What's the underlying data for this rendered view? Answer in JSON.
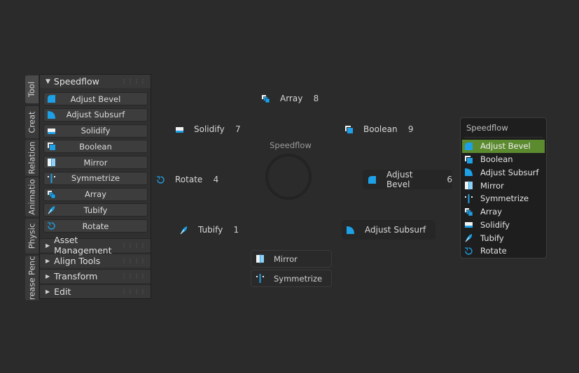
{
  "side_tabs": [
    "Tool",
    "Creat",
    "Relation",
    "Animatio",
    "Physic",
    "rease Penc"
  ],
  "panel": {
    "title": "Speedflow",
    "buttons": [
      {
        "label": "Adjust Bevel",
        "icon": "bevel-icon"
      },
      {
        "label": "Adjust Subsurf",
        "icon": "subsurf-icon"
      },
      {
        "label": "Solidify",
        "icon": "solidify-icon"
      },
      {
        "label": "Boolean",
        "icon": "boolean-icon"
      },
      {
        "label": "Mirror",
        "icon": "mirror-icon"
      },
      {
        "label": "Symmetrize",
        "icon": "symmetrize-icon"
      },
      {
        "label": "Array",
        "icon": "array-icon"
      },
      {
        "label": "Tubify",
        "icon": "tubify-icon"
      },
      {
        "label": "Rotate",
        "icon": "rotate-icon"
      }
    ],
    "sections": [
      "Asset Management",
      "Align Tools",
      "Transform",
      "Edit"
    ]
  },
  "pie": {
    "title": "Speedflow",
    "items": [
      {
        "label": "Array",
        "num": "8",
        "icon": "array-icon"
      },
      {
        "label": "Solidify",
        "num": "7",
        "icon": "solidify-icon"
      },
      {
        "label": "Boolean",
        "num": "9",
        "icon": "boolean-icon"
      },
      {
        "label": "Rotate",
        "num": "4",
        "icon": "rotate-icon"
      },
      {
        "label": "Adjust Bevel",
        "num": "6",
        "icon": "bevel-icon"
      },
      {
        "label": "Tubify",
        "num": "1",
        "icon": "tubify-icon"
      },
      {
        "label": "Adjust Subsurf",
        "num": "",
        "icon": "subsurf-icon"
      }
    ],
    "extras": [
      {
        "label": "Mirror",
        "icon": "mirror-icon"
      },
      {
        "label": "Symmetrize",
        "icon": "symmetrize-icon"
      }
    ]
  },
  "menu": {
    "title": "Speedflow",
    "items": [
      {
        "label": "Adjust Bevel",
        "icon": "bevel-icon",
        "selected": true
      },
      {
        "label": "Boolean",
        "icon": "boolean-icon"
      },
      {
        "label": "Adjust Subsurf",
        "icon": "subsurf-icon"
      },
      {
        "label": "Mirror",
        "icon": "mirror-icon"
      },
      {
        "label": "Symmetrize",
        "icon": "symmetrize-icon"
      },
      {
        "label": "Array",
        "icon": "array-icon"
      },
      {
        "label": "Solidify",
        "icon": "solidify-icon"
      },
      {
        "label": "Tubify",
        "icon": "tubify-icon"
      },
      {
        "label": "Rotate",
        "icon": "rotate-icon"
      }
    ]
  },
  "colors": {
    "accent": "#1ea0e6",
    "highlight": "#5b8a2f",
    "background": "#2b2b2b"
  }
}
